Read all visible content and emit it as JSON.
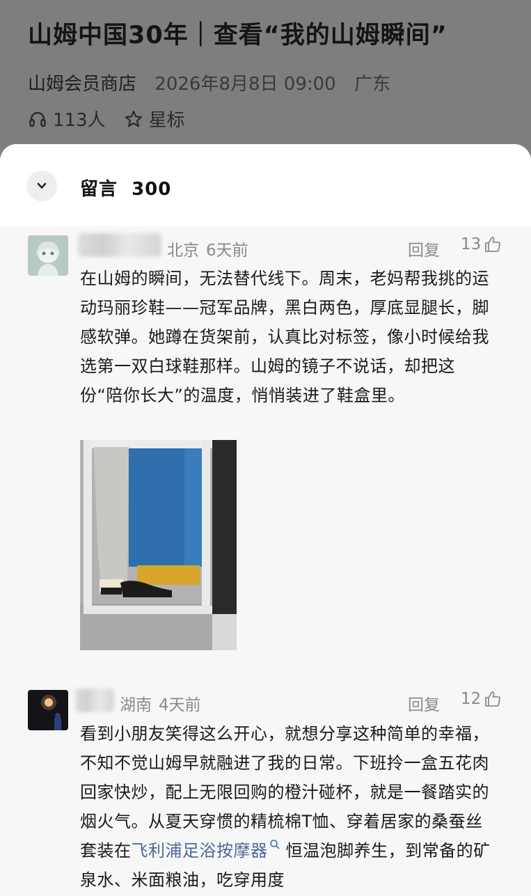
{
  "article": {
    "title": "山姆中国30年｜查看“我的山姆瞬间”",
    "account": "山姆会员商店",
    "date": "2026年8月8日 09:00",
    "region": "广东",
    "listeners": "113人",
    "star_label": "星标"
  },
  "comments_sheet": {
    "title": "留言",
    "count": "300",
    "collapse_icon": "chevron-down-icon"
  },
  "comments": [
    {
      "location": "北京",
      "time_ago": "6天前",
      "reply_label": "回复",
      "likes": "13",
      "text": "在山姆的瞬间，无法替代线下。周末，老妈帮我挑的运动玛丽珍鞋——冠军品牌，黑白两色，厚底显腿长，脚感软弹。她蹲在货架前，认真比对标签，像小时候给我选第一双白球鞋那样。山姆的镜子不说话，却把这份“陪你长大”的温度，悄悄装进了鞋盒里。"
    },
    {
      "location": "湖南",
      "time_ago": "4天前",
      "reply_label": "回复",
      "likes": "12",
      "text_before": "看到小朋友笑得这么开心，就想分享这种简单的幸福，不知不觉山姆早就融进了我的日常。下班拎一盒五花肉回家快炒，配上无限回购的橙汁碰杯，就是一餐踏实的烟火气。从夏天穿惯的精梳棉T恤、穿着居家的桑蚕丝套装在",
      "link_text": "飞利浦足浴按摩器",
      "text_after": " 恒温泡脚养生，到常备的矿泉水、米面粮油，吃穿用度"
    }
  ],
  "colors": {
    "overlay": "#7e7e7e",
    "link": "#4b6a9b",
    "meta_gray": "#8a8a8a"
  }
}
